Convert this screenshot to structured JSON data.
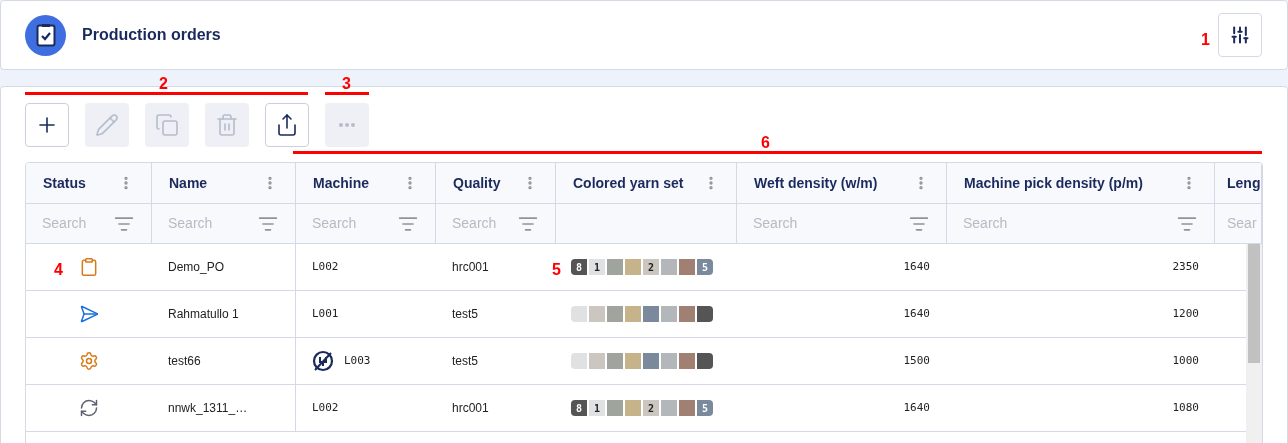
{
  "header": {
    "title": "Production orders"
  },
  "toolbar": [
    {
      "kind": "add",
      "disabled": false
    },
    {
      "kind": "edit",
      "disabled": true
    },
    {
      "kind": "copy",
      "disabled": true
    },
    {
      "kind": "delete",
      "disabled": true
    },
    {
      "kind": "export",
      "disabled": false
    },
    {
      "kind": "more",
      "disabled": true
    }
  ],
  "table": {
    "columns": [
      {
        "label": "Status",
        "placeholder": "Search"
      },
      {
        "label": "Name",
        "placeholder": "Search"
      },
      {
        "label": "Machine",
        "placeholder": "Search"
      },
      {
        "label": "Quality",
        "placeholder": "Search"
      },
      {
        "label": "Colored yarn set"
      },
      {
        "label": "Weft density (w/m)",
        "placeholder": "Search"
      },
      {
        "label": "Machine pick density (p/m)",
        "placeholder": "Search"
      },
      {
        "label": "Leng",
        "placeholder": "Sear"
      }
    ],
    "rows": [
      {
        "kind": "planned",
        "name": "Demo_PO",
        "machine": "L002",
        "machine_offline": false,
        "quality": "hrc001",
        "yarns": [
          {
            "color": "#555555",
            "label": "8"
          },
          {
            "color": "#e0e1e3",
            "label": "1"
          },
          {
            "color": "#9fa59d"
          },
          {
            "color": "#c7b38a"
          },
          {
            "color": "#cbc7c0",
            "label": "2"
          },
          {
            "color": "#b3b7ba"
          },
          {
            "color": "#a08073"
          },
          {
            "color": "#7a899b",
            "label": "5"
          }
        ],
        "weft_density": "1640",
        "pick_density": "2350"
      },
      {
        "kind": "sent",
        "name": "Rahmatullo 1",
        "machine": "L001",
        "machine_offline": false,
        "quality": "test5",
        "yarns": [
          {
            "color": "#e0e1e3"
          },
          {
            "color": "#cbc7c0"
          },
          {
            "color": "#9fa59d"
          },
          {
            "color": "#c7b38a"
          },
          {
            "color": "#7a899b"
          },
          {
            "color": "#b3b7ba"
          },
          {
            "color": "#a08073"
          },
          {
            "color": "#555555"
          }
        ],
        "weft_density": "1640",
        "pick_density": "1200"
      },
      {
        "kind": "processing",
        "name": "test66",
        "machine": "L003",
        "machine_offline": true,
        "quality": "test5",
        "yarns": [
          {
            "color": "#e0e1e3"
          },
          {
            "color": "#cbc7c0"
          },
          {
            "color": "#9fa59d"
          },
          {
            "color": "#c7b38a"
          },
          {
            "color": "#7a899b"
          },
          {
            "color": "#b3b7ba"
          },
          {
            "color": "#a08073"
          },
          {
            "color": "#555555"
          }
        ],
        "weft_density": "1500",
        "pick_density": "1000"
      },
      {
        "kind": "syncing",
        "name": "nnwk_1311_…",
        "machine": "L002",
        "machine_offline": false,
        "quality": "hrc001",
        "yarns": [
          {
            "color": "#555555",
            "label": "8"
          },
          {
            "color": "#e0e1e3",
            "label": "1"
          },
          {
            "color": "#9fa59d"
          },
          {
            "color": "#c7b38a"
          },
          {
            "color": "#cbc7c0",
            "label": "2"
          },
          {
            "color": "#b3b7ba"
          },
          {
            "color": "#a08073"
          },
          {
            "color": "#7a899b",
            "label": "5"
          }
        ],
        "weft_density": "1640",
        "pick_density": "1080"
      }
    ]
  },
  "annotations": [
    {
      "label": "1",
      "underlined": false
    },
    {
      "label": "2",
      "underlined": true
    },
    {
      "label": "3",
      "underlined": true
    },
    {
      "label": "4",
      "underlined": false
    },
    {
      "label": "5",
      "underlined": false
    },
    {
      "label": "6",
      "underlined": true
    }
  ]
}
